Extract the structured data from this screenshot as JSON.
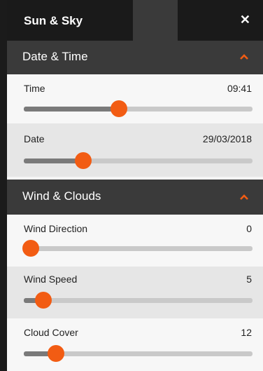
{
  "window": {
    "title": "Sun & Sky",
    "close_glyph": "✕"
  },
  "accent_color": "#f25c13",
  "sections": [
    {
      "label": "Date & Time",
      "collapse_icon": "chevron-up-icon",
      "controls": [
        {
          "label": "Time",
          "value": "09:41",
          "level": 0.415
        },
        {
          "label": "Date",
          "value": "29/03/2018",
          "level": 0.26
        }
      ]
    },
    {
      "label": "Wind & Clouds",
      "collapse_icon": "chevron-up-icon",
      "controls": [
        {
          "label": "Wind Direction",
          "value": "0",
          "level": 0.03
        },
        {
          "label": "Wind Speed",
          "value": "5",
          "level": 0.085
        },
        {
          "label": "Cloud Cover",
          "value": "12",
          "level": 0.14
        }
      ]
    }
  ]
}
